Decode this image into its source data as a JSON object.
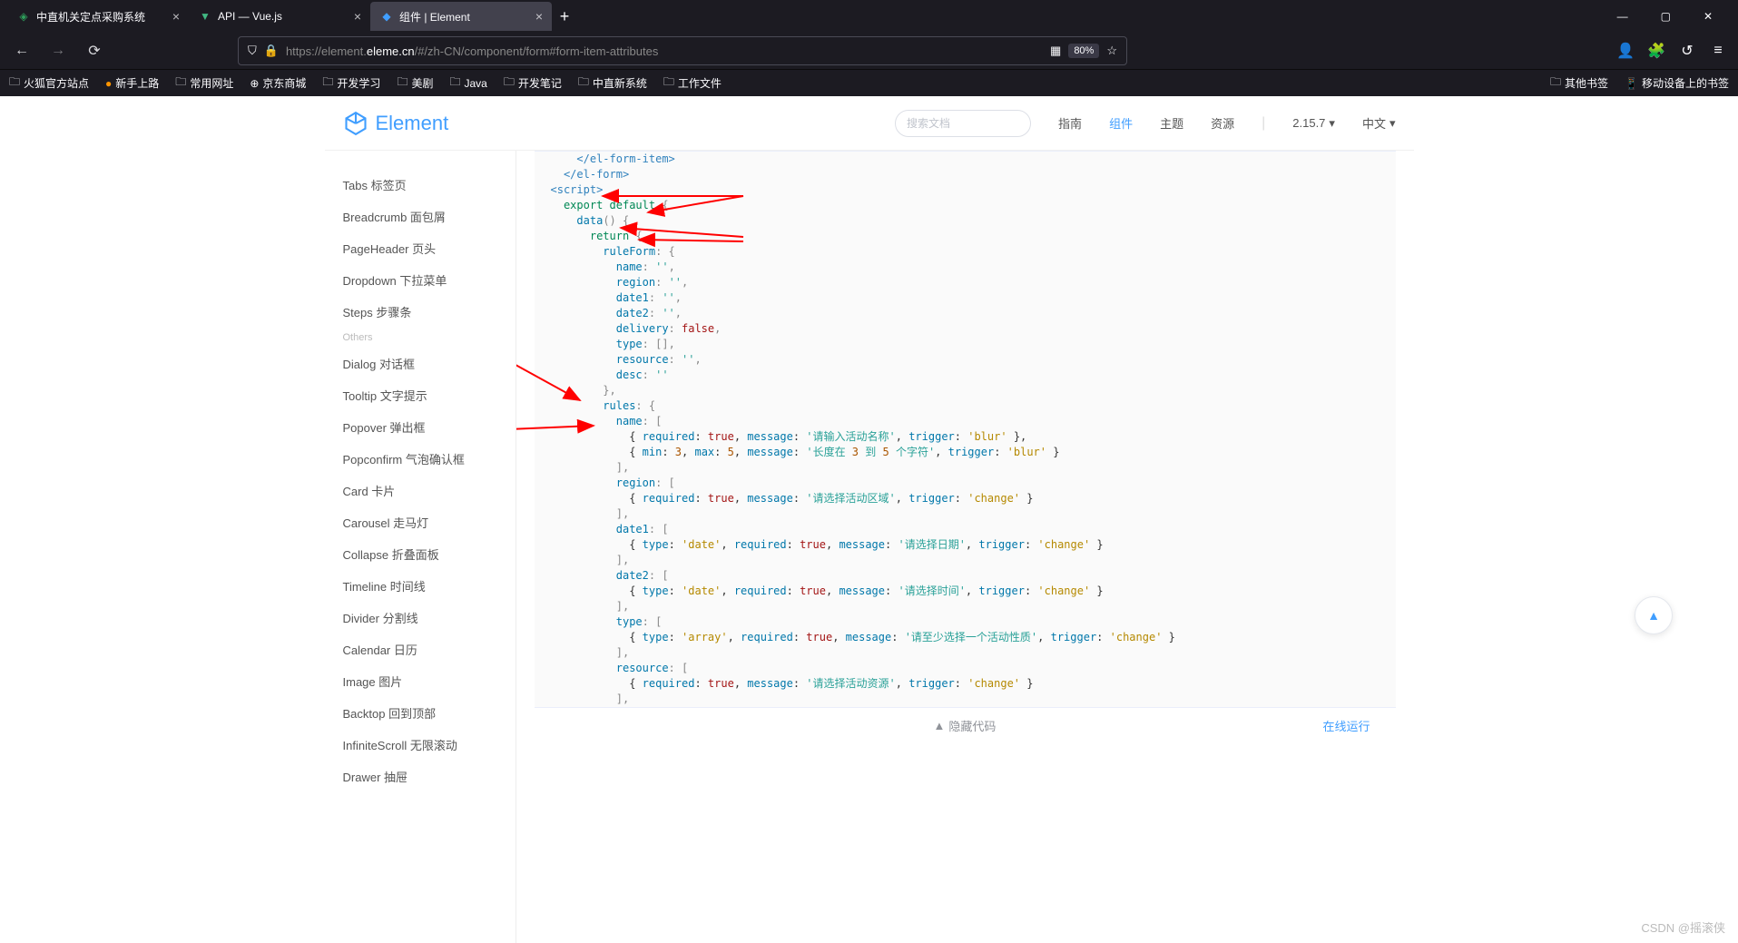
{
  "browser": {
    "tabs": [
      {
        "title": "中直机关定点采购系统",
        "icon_color": "#2e9e5b"
      },
      {
        "title": "API — Vue.js",
        "icon_color": "#41b883"
      },
      {
        "title": "组件 | Element",
        "icon_color": "#409eff",
        "active": true
      }
    ],
    "url_dim_pre": "https://element.",
    "url_host": "eleme.cn",
    "url_dim_post": "/#/zh-CN/component/form#form-item-attributes",
    "zoom": "80%",
    "bookmarks_left": [
      "火狐官方站点",
      "新手上路",
      "常用网址",
      "京东商城",
      "开发学习",
      "美剧",
      "Java",
      "开发笔记",
      "中直新系统",
      "工作文件"
    ],
    "bookmarks_right": [
      "其他书签",
      "移动设备上的书签"
    ]
  },
  "element": {
    "logo_text": "Element",
    "search_placeholder": "搜索文档",
    "nav": {
      "guide": "指南",
      "component": "组件",
      "theme": "主题",
      "resource": "资源"
    },
    "version": "2.15.7",
    "lang": "中文",
    "sidebar": {
      "nav_items": [
        "Tabs 标签页",
        "Breadcrumb 面包屑",
        "PageHeader 页头",
        "Dropdown 下拉菜单",
        "Steps 步骤条"
      ],
      "others_label": "Others",
      "others_items": [
        "Dialog 对话框",
        "Tooltip 文字提示",
        "Popover 弹出框",
        "Popconfirm 气泡确认框",
        "Card 卡片",
        "Carousel 走马灯",
        "Collapse 折叠面板",
        "Timeline 时间线",
        "Divider 分割线",
        "Calendar 日历",
        "Image 图片",
        "Backtop 回到顶部",
        "InfiniteScroll 无限滚动",
        "Drawer 抽屉"
      ]
    },
    "code": {
      "top_tags": [
        "</el-form-item>",
        "</el-form>",
        "<script>"
      ],
      "export_line": "export default {",
      "data_line": "data() {",
      "return_line": "return {",
      "ruleform_label": "ruleForm:",
      "ruleform_fields": [
        {
          "k": "name",
          "v": "''"
        },
        {
          "k": "region",
          "v": "''"
        },
        {
          "k": "date1",
          "v": "''"
        },
        {
          "k": "date2",
          "v": "''"
        },
        {
          "k": "delivery",
          "v": "false"
        },
        {
          "k": "type",
          "v": "[]"
        },
        {
          "k": "resource",
          "v": "''"
        },
        {
          "k": "desc",
          "v": "''"
        }
      ],
      "rules_label": "rules:",
      "rules": {
        "name": [
          "{ required: true, message: '请输入活动名称', trigger: 'blur' },",
          "{ min: 3, max: 5, message: '长度在 3 到 5 个字符', trigger: 'blur' }"
        ],
        "region": [
          "{ required: true, message: '请选择活动区域', trigger: 'change' }"
        ],
        "date1": [
          "{ type: 'date', required: true, message: '请选择日期', trigger: 'change' }"
        ],
        "date2": [
          "{ type: 'date', required: true, message: '请选择时间', trigger: 'change' }"
        ],
        "type": [
          "{ type: 'array', required: true, message: '请至少选择一个活动性质', trigger: 'change' }"
        ],
        "resource": [
          "{ required: true, message: '请选择活动资源', trigger: 'change' }"
        ]
      }
    },
    "footer": {
      "hide": "隐藏代码",
      "run": "在线运行"
    }
  },
  "watermark": "CSDN @摇滚侠"
}
